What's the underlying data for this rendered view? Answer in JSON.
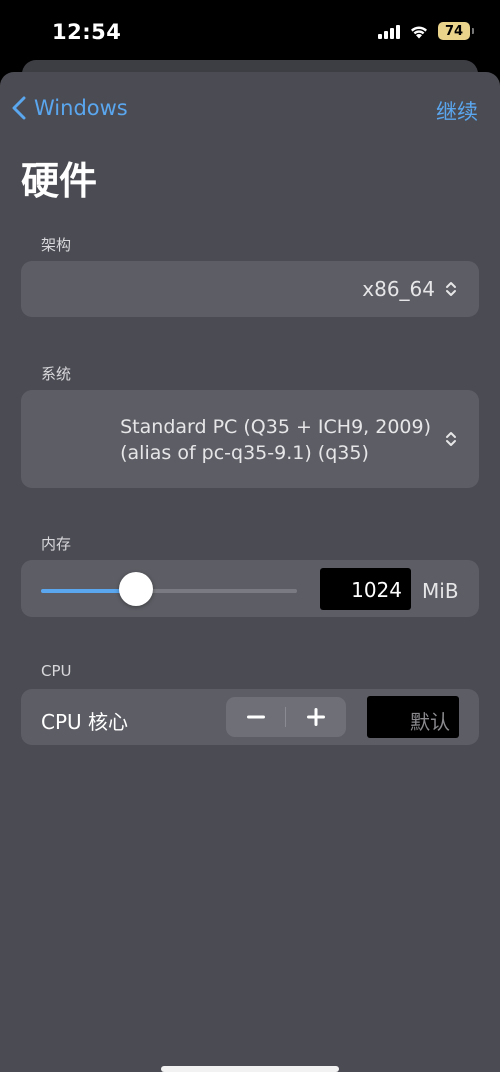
{
  "status_bar": {
    "time": "12:54",
    "battery": "74",
    "icons": [
      "cellular-signal-icon",
      "wifi-icon",
      "battery-icon"
    ]
  },
  "nav": {
    "back_label": "Windows",
    "continue_label": "继续"
  },
  "page": {
    "title": "硬件"
  },
  "architecture": {
    "label": "架构",
    "value": "x86_64"
  },
  "system": {
    "label": "系统",
    "value_line1": "Standard PC (Q35 + ICH9, 2009)",
    "value_line2": "(alias of pc-q35-9.1) (q35)"
  },
  "memory": {
    "label": "内存",
    "value": "1024",
    "unit": "MiB",
    "slider_fraction": 0.37
  },
  "cpu": {
    "section_label": "CPU",
    "cores_label": "CPU 核心",
    "cores_placeholder": "默认",
    "decrement_symbol": "−",
    "increment_symbol": "+"
  },
  "colors": {
    "accent": "#5aa6ef",
    "sheet_background": "#4b4c53",
    "card_background": "#5d5e65",
    "battery": "#ead38b"
  }
}
